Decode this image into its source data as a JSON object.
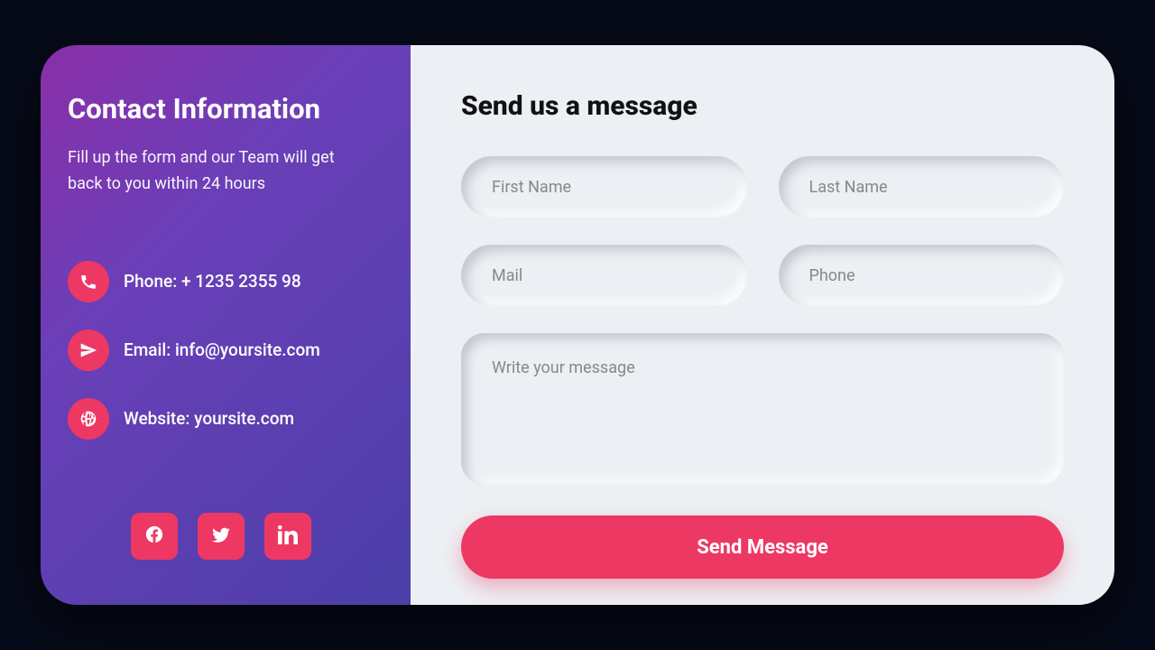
{
  "info": {
    "title": "Contact Information",
    "subtitle": "Fill up the form and our Team will get back to you within 24 hours",
    "phone": "Phone: + 1235 2355 98",
    "email": "Email: info@yoursite.com",
    "website": "Website: yoursite.com"
  },
  "form": {
    "title": "Send us a message",
    "first_name_placeholder": "First Name",
    "last_name_placeholder": "Last Name",
    "mail_placeholder": "Mail",
    "phone_placeholder": "Phone",
    "message_placeholder": "Write your message",
    "submit_label": "Send Message"
  },
  "colors": {
    "accent": "#ed3864",
    "gradient_start": "#8a2fa8",
    "gradient_end": "#4b3fa8",
    "form_bg": "#eceff3",
    "page_bg": "#060a18"
  }
}
